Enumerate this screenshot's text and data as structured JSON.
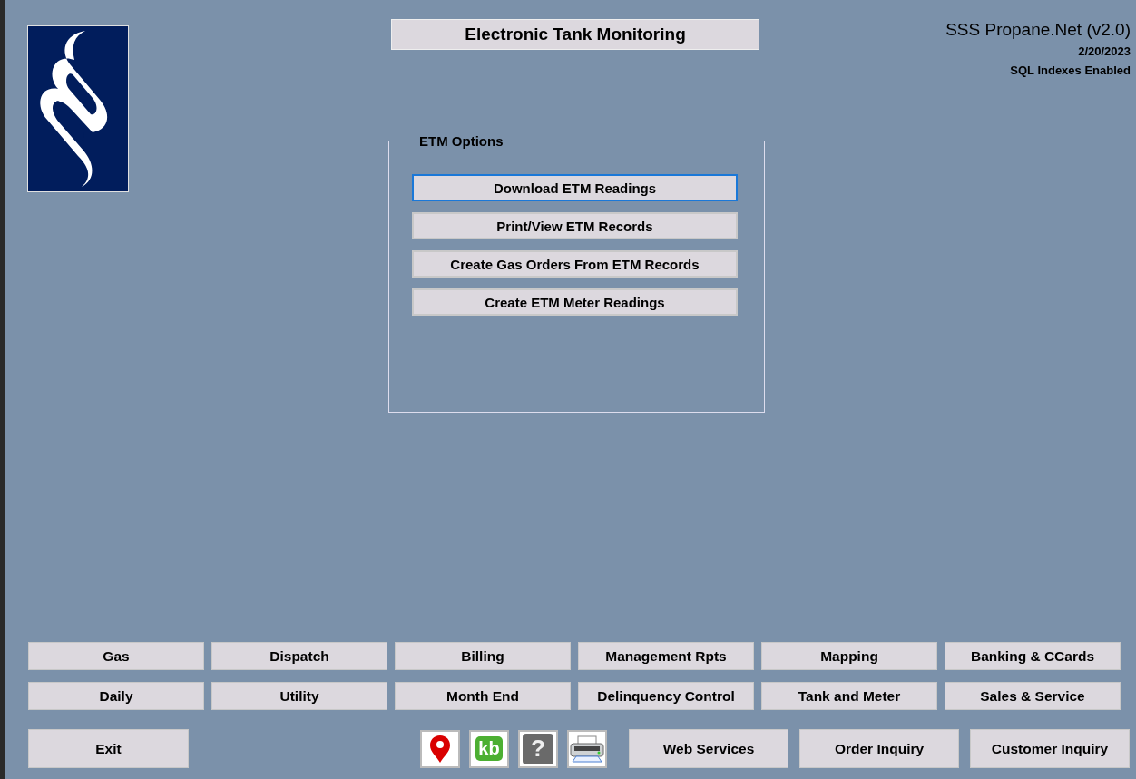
{
  "title": "Electronic Tank Monitoring",
  "app_info": {
    "name": "SSS Propane.Net (v2.0)",
    "date": "2/20/2023",
    "status": "SQL Indexes Enabled"
  },
  "etm_options": {
    "label": "ETM Options",
    "buttons": [
      {
        "label": "Download ETM Readings",
        "focused": true
      },
      {
        "label": "Print/View ETM Records",
        "focused": false
      },
      {
        "label": "Create Gas Orders From ETM Records",
        "focused": false
      },
      {
        "label": "Create ETM Meter Readings",
        "focused": false
      }
    ]
  },
  "nav_buttons": [
    "Gas",
    "Dispatch",
    "Billing",
    "Management Rpts",
    "Mapping",
    "Banking & CCards",
    "Daily",
    "Utility",
    "Month End",
    "Delinquency Control",
    "Tank and Meter",
    "Sales & Service"
  ],
  "exit_button": "Exit",
  "toolbar_icons": [
    {
      "kind": "pin"
    },
    {
      "kind": "kb",
      "text": "kb"
    },
    {
      "kind": "help",
      "text": "?"
    },
    {
      "kind": "printer"
    }
  ],
  "bottom_buttons": [
    "Web Services",
    "Order Inquiry",
    "Customer Inquiry"
  ]
}
